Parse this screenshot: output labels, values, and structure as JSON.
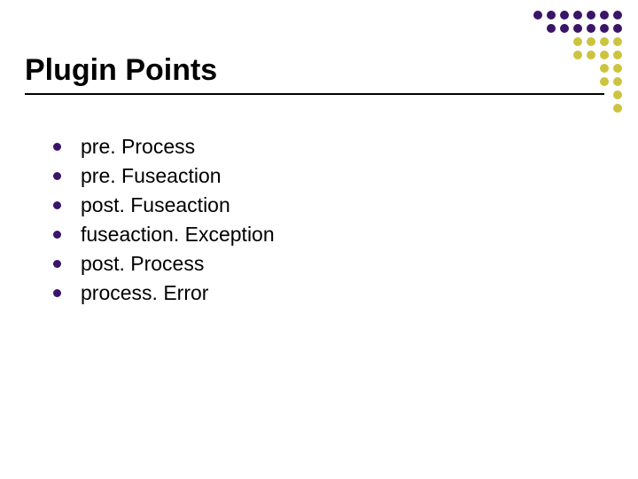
{
  "title": "Plugin Points",
  "bullets": [
    "pre. Process",
    "pre. Fuseaction",
    "post. Fuseaction",
    "fuseaction. Exception",
    "post. Process",
    "process. Error"
  ],
  "decoration": {
    "purple": "#3a1567",
    "yellow": "#ccc43f"
  }
}
